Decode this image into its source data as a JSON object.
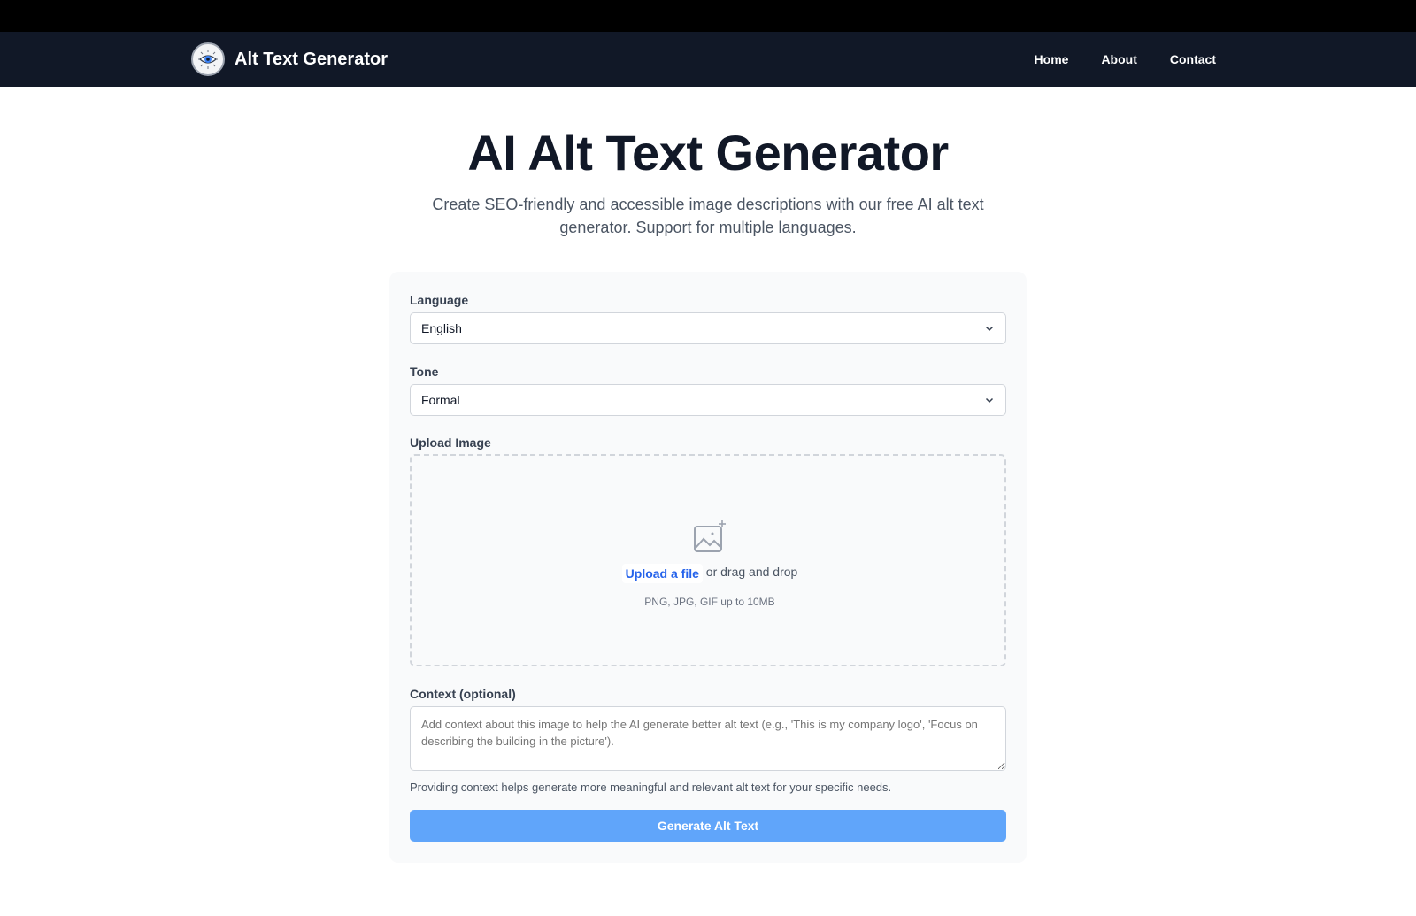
{
  "header": {
    "brand": "Alt Text Generator",
    "logo_icon": "eye-icon",
    "nav": [
      {
        "label": "Home"
      },
      {
        "label": "About"
      },
      {
        "label": "Contact"
      }
    ]
  },
  "hero": {
    "title": "AI Alt Text Generator",
    "subtitle": "Create SEO-friendly and accessible image descriptions with our free AI alt text generator. Support for multiple languages."
  },
  "form": {
    "language": {
      "label": "Language",
      "value": "English"
    },
    "tone": {
      "label": "Tone",
      "value": "Formal"
    },
    "upload": {
      "label": "Upload Image",
      "icon": "image-add-icon",
      "link": "Upload a file",
      "text": "or drag and drop",
      "hint": "PNG, JPG, GIF up to 10MB"
    },
    "context": {
      "label": "Context (optional)",
      "placeholder": "Add context about this image to help the AI generate better alt text (e.g., 'This is my company logo', 'Focus on describing the building in the picture').",
      "help": "Providing context helps generate more meaningful and relevant alt text for your specific needs."
    },
    "submit": "Generate Alt Text"
  },
  "colors": {
    "navbar": "#111827",
    "accent": "#2563eb",
    "button": "#60a5fa",
    "card": "#f9fafb"
  }
}
